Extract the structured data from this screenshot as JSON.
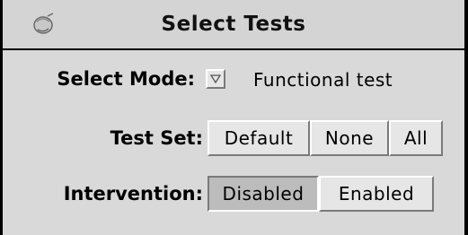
{
  "window": {
    "title": "Select Tests",
    "menu_icon": "window-menu-icon"
  },
  "select_mode": {
    "label": "Select Mode:",
    "value": "Functional test",
    "dropdown_icon": "chevron-down-icon"
  },
  "test_set": {
    "label": "Test Set:",
    "options": [
      "Default",
      "None",
      "All"
    ]
  },
  "intervention": {
    "label": "Intervention:",
    "options": [
      "Disabled",
      "Enabled"
    ],
    "selected": "Disabled"
  },
  "colors": {
    "panel": "#d9d9d9",
    "pressed": "#bcbcbc",
    "frame": "#000000"
  }
}
